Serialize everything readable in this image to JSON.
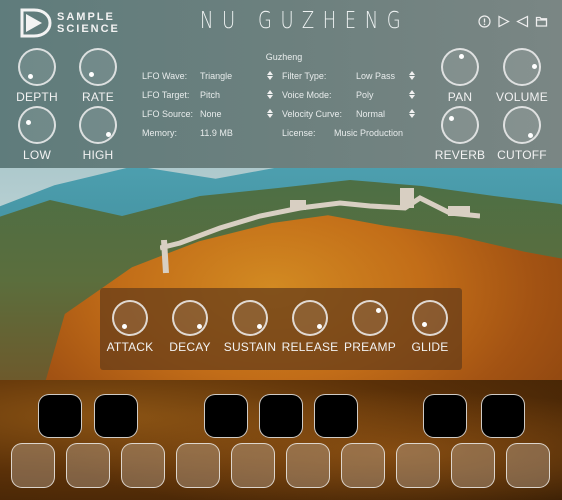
{
  "header": {
    "brand_line1": "SAMPLE",
    "brand_line2": "SCIENCE",
    "title": "NU GUZHENG",
    "icons": [
      "info-icon",
      "play-icon",
      "back-icon",
      "folder-icon"
    ]
  },
  "left_knobs": [
    {
      "label": "DEPTH",
      "value": 0.15
    },
    {
      "label": "RATE",
      "value": 0.2
    },
    {
      "label": "LOW",
      "value": 0.3
    },
    {
      "label": "HIGH",
      "value": 0.85
    }
  ],
  "right_knobs": [
    {
      "label": "PAN",
      "value": 0.5
    },
    {
      "label": "VOLUME",
      "value": 0.75
    },
    {
      "label": "REVERB",
      "value": 0.35
    },
    {
      "label": "CUTOFF",
      "value": 0.85
    }
  ],
  "info": {
    "instrument": "Guzheng",
    "rows": [
      {
        "label": "LFO Wave:",
        "value": "Triangle",
        "label2": "Filter Type:",
        "value2": "Low Pass"
      },
      {
        "label": "LFO Target:",
        "value": "Pitch",
        "label2": "Voice Mode:",
        "value2": "Poly"
      },
      {
        "label": "LFO Source:",
        "value": "None",
        "label2": "Velocity Curve:",
        "value2": "Normal"
      }
    ],
    "memory_label": "Memory:",
    "memory_value": "11.9 MB",
    "license_label": "License:",
    "license_value": "Music Production"
  },
  "envelope_knobs": [
    {
      "label": "ATTACK",
      "value": 0.2
    },
    {
      "label": "DECAY",
      "value": 0.8
    },
    {
      "label": "SUSTAIN",
      "value": 0.8
    },
    {
      "label": "RELEASE",
      "value": 0.85
    },
    {
      "label": "PREAMP",
      "value": 0.6
    },
    {
      "label": "GLIDE",
      "value": 0.2
    }
  ],
  "keyboard": {
    "black_keys": 7,
    "white_keys": 10
  }
}
